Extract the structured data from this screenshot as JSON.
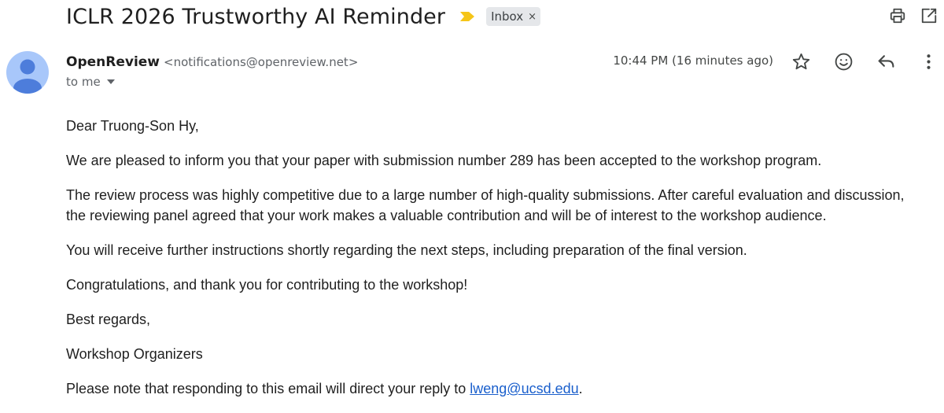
{
  "email": {
    "subject": "ICLR 2026 Trustworthy AI Reminder",
    "label": "Inbox",
    "label_remove": "×",
    "sender_name": "OpenReview",
    "sender_email": "<notifications@openreview.net>",
    "recipient": "to me",
    "time": "10:44 PM (16 minutes ago)"
  },
  "body": {
    "greeting": "Dear Truong-Son Hy,",
    "p1": "We are pleased to inform you that your paper with submission number 289 has been accepted to the workshop program.",
    "p2": "The review process was highly competitive due to a large number of high-quality submissions. After careful evaluation and discussion, the reviewing panel agreed that your work makes a valuable contribution and will be of interest to the workshop audience.",
    "p3": "You will receive further instructions shortly regarding the next steps, including preparation of the final version.",
    "p4": "Congratulations, and thank you for contributing to the workshop!",
    "closing": "Best regards,",
    "signature": "Workshop Organizers",
    "note_prefix": "Please note that responding to this email will direct your reply to ",
    "note_link": "lweng@ucsd.edu",
    "note_suffix": "."
  },
  "icons": {
    "importance": "importance-marker-icon",
    "print": "print-icon",
    "open_new_window": "open-in-new-window-icon",
    "star": "star-icon",
    "emoji": "emoji-reaction-icon",
    "reply": "reply-icon",
    "more": "more-vertical-icon",
    "avatar": "avatar-person-icon"
  },
  "colors": {
    "importance": "#f5c518",
    "link": "#1a5fcc",
    "label_chip": "#e5e7ea",
    "avatar_bg": "#a8c7fa",
    "avatar_fg": "#4d7ddb"
  }
}
